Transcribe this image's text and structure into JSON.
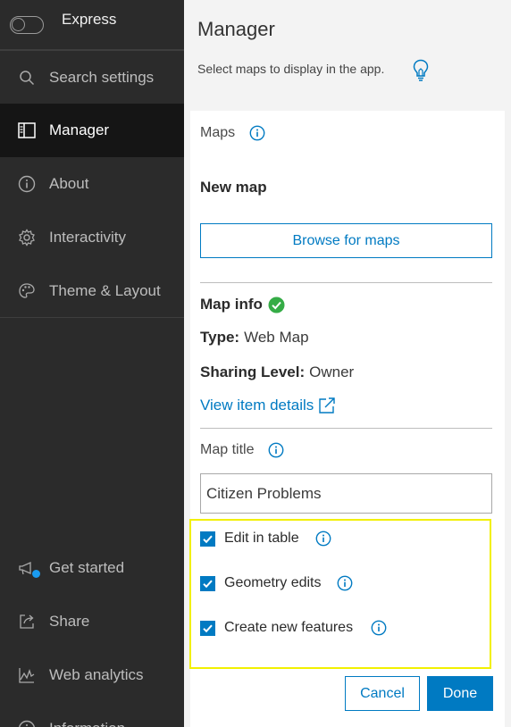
{
  "sidebar": {
    "toggle_label": "Express",
    "items": [
      {
        "label": "Search settings",
        "icon": "search-icon"
      },
      {
        "label": "Manager",
        "icon": "panel-icon",
        "active": true
      },
      {
        "label": "About",
        "icon": "info-icon"
      },
      {
        "label": "Interactivity",
        "icon": "gear-icon"
      },
      {
        "label": "Theme & Layout",
        "icon": "palette-icon"
      }
    ],
    "bottom_items": [
      {
        "label": "Get started",
        "icon": "megaphone-icon"
      },
      {
        "label": "Share",
        "icon": "share-icon"
      },
      {
        "label": "Web analytics",
        "icon": "analytics-icon"
      },
      {
        "label": "Information",
        "icon": "info-icon"
      }
    ]
  },
  "main": {
    "title": "Manager",
    "subtitle": "Select maps to display in the app.",
    "maps_label": "Maps",
    "new_map_label": "New map",
    "browse_button": "Browse for maps",
    "map_info_label": "Map info",
    "type_label": "Type:",
    "type_value": "Web Map",
    "sharing_label": "Sharing Level:",
    "sharing_value": "Owner",
    "view_details_link": "View item details",
    "map_title_label": "Map title",
    "map_title_value": "Citizen Problems",
    "checkboxes": [
      {
        "label": "Edit in table",
        "checked": true
      },
      {
        "label": "Geometry edits",
        "checked": true
      },
      {
        "label": "Create new features",
        "checked": true
      }
    ],
    "cancel_button": "Cancel",
    "done_button": "Done"
  },
  "colors": {
    "accent": "#007ac2",
    "sidebar_bg": "#2b2b2b",
    "active_bg": "#151515",
    "success": "#35ac46",
    "highlight": "#f2f000"
  }
}
